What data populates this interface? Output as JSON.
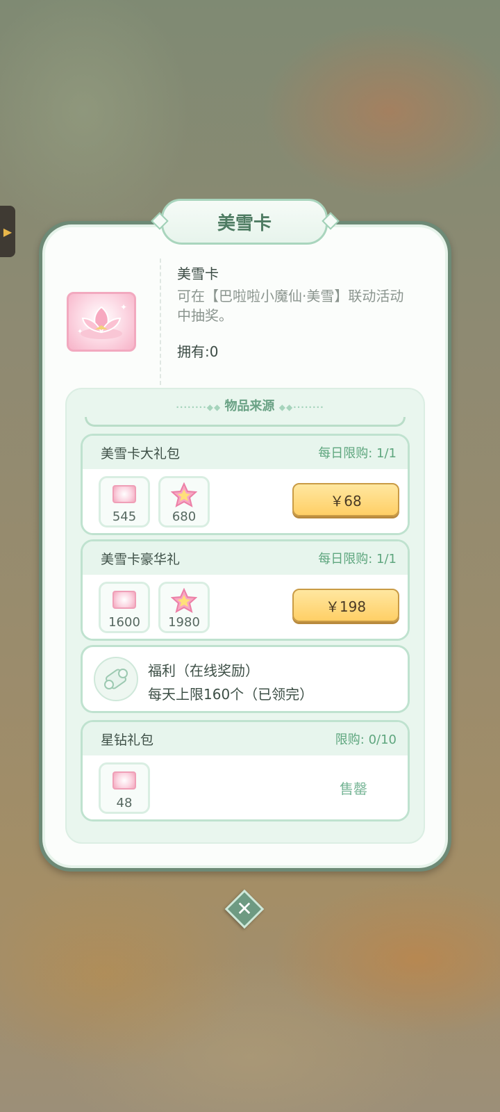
{
  "dialog": {
    "title": "美雪卡"
  },
  "item": {
    "name": "美雪卡",
    "description": "可在【巴啦啦小魔仙·美雪】联动活动中抽奖。",
    "owned_label": "拥有:0"
  },
  "source": {
    "title": "物品来源",
    "packs": [
      {
        "name": "美雪卡大礼包",
        "limit": "每日限购: 1/1",
        "rewards": [
          {
            "icon": "meixue-card-icon",
            "count": "545"
          },
          {
            "icon": "pink-star-icon",
            "count": "680"
          }
        ],
        "price": "￥68"
      },
      {
        "name": "美雪卡豪华礼",
        "limit": "每日限购: 1/1",
        "rewards": [
          {
            "icon": "meixue-card-icon",
            "count": "1600"
          },
          {
            "icon": "pink-star-icon",
            "count": "1980"
          }
        ],
        "price": "￥198"
      }
    ],
    "welfare": {
      "icon": "scroll-icon",
      "line1": "福利（在线奖励）",
      "line2": "每天上限160个（已领完）"
    },
    "star_pack": {
      "name": "星钻礼包",
      "limit": "限购: 0/10",
      "rewards": [
        {
          "icon": "meixue-card-icon",
          "count": "48"
        }
      ],
      "status": "售罄"
    }
  },
  "colors": {
    "accent_green": "#5ea67e",
    "button_gold": "#ffcf66",
    "card_pink": "#f3a7bd"
  }
}
